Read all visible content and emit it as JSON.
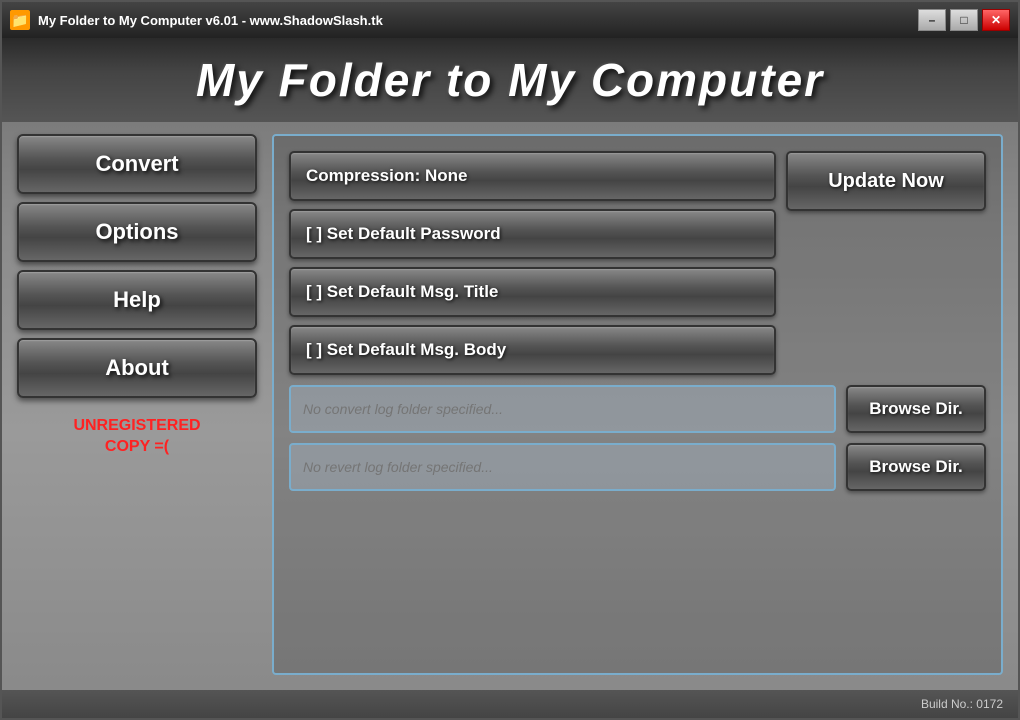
{
  "titlebar": {
    "icon": "📁",
    "text": "My Folder to My Computer v6.01 - www.ShadowSlash.tk",
    "minimize_label": "–",
    "maximize_label": "□",
    "close_label": "✕"
  },
  "app_title": "My Folder to My Computer",
  "nav": {
    "convert_label": "Convert",
    "options_label": "Options",
    "help_label": "Help",
    "about_label": "About",
    "unregistered_line1": "UNREGISTERED",
    "unregistered_line2": "COPY =("
  },
  "options": {
    "compression_label": "Compression: None",
    "password_label": "[ ] Set Default Password",
    "msg_title_label": "[ ] Set Default Msg. Title",
    "msg_body_label": "[ ] Set Default Msg. Body",
    "update_label": "Update Now",
    "convert_log_placeholder": "No convert log folder specified...",
    "revert_log_placeholder": "No revert log folder specified...",
    "browse_label": "Browse Dir."
  },
  "statusbar": {
    "build_label": "Build No.: 0172"
  }
}
